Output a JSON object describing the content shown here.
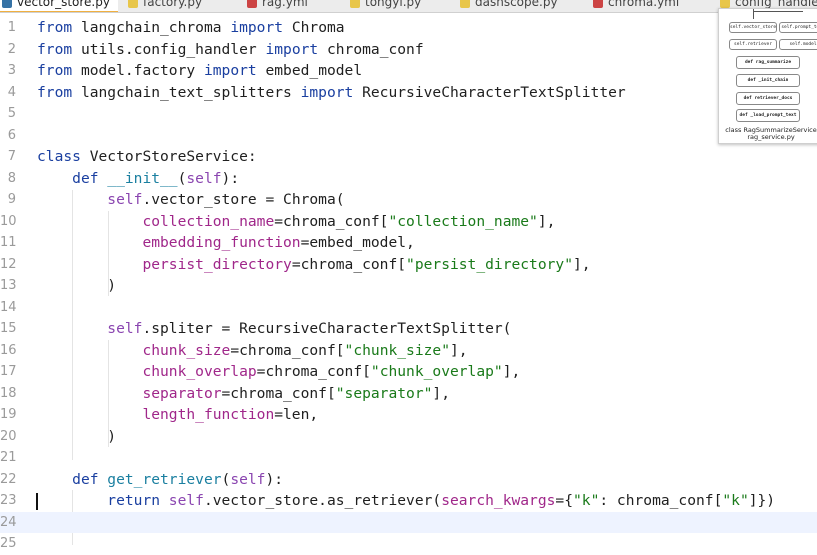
{
  "tabs": [
    {
      "label": "vector_store.py",
      "active": true,
      "icon": "python-file-icon",
      "color": "#3572A5"
    },
    {
      "label": "factory.py",
      "active": false,
      "icon": "python-file-icon",
      "color": "#e8c64a"
    },
    {
      "label": "rag.yml",
      "active": false,
      "icon": "yaml-file-icon",
      "color": "#cc4444"
    },
    {
      "label": "tongyi.py",
      "active": false,
      "icon": "python-file-icon",
      "color": "#e8c64a"
    },
    {
      "label": "dashscope.py",
      "active": false,
      "icon": "python-file-icon",
      "color": "#e8c64a"
    },
    {
      "label": "chroma.yml",
      "active": false,
      "icon": "yaml-file-icon",
      "color": "#cc4444"
    },
    {
      "label": "config_handler.py",
      "active": false,
      "icon": "python-file-icon",
      "color": "#e8c64a"
    }
  ],
  "editor": {
    "current_line": 24,
    "lines": [
      {
        "n": "1",
        "t": [
          [
            "kw",
            "from"
          ],
          [
            "",
            "langchain_chroma"
          ],
          [
            "kw",
            "import"
          ],
          [
            "",
            "Chroma"
          ]
        ]
      },
      {
        "n": "2",
        "t": [
          [
            "kw",
            "from"
          ],
          [
            "",
            "utils.config_handler"
          ],
          [
            "kw",
            "import"
          ],
          [
            "",
            "chroma_conf"
          ]
        ]
      },
      {
        "n": "3",
        "t": [
          [
            "kw",
            "from"
          ],
          [
            "",
            "model.factory"
          ],
          [
            "kw",
            "import"
          ],
          [
            "",
            "embed_model"
          ]
        ]
      },
      {
        "n": "4",
        "t": [
          [
            "kw",
            "from"
          ],
          [
            "",
            "langchain_text_splitters"
          ],
          [
            "kw",
            "import"
          ],
          [
            "",
            "RecursiveCharacterTextSplitter"
          ]
        ]
      },
      {
        "n": "5",
        "t": []
      },
      {
        "n": "6",
        "t": []
      },
      {
        "n": "7",
        "t": [
          [
            "kw",
            "class"
          ],
          [
            "",
            "VectorStoreService:"
          ]
        ]
      },
      {
        "n": "8",
        "t": [
          [
            "",
            "    "
          ],
          [
            "kw",
            "def"
          ],
          [
            "fn",
            "__init__"
          ],
          [
            "",
            "("
          ],
          [
            "sf",
            "self"
          ],
          [
            "",
            "):"
          ]
        ]
      },
      {
        "n": "9",
        "t": [
          [
            "",
            "        "
          ],
          [
            "sf",
            "self"
          ],
          [
            "",
            ".vector_store = Chroma("
          ]
        ]
      },
      {
        "n": "10",
        "t": [
          [
            "",
            "            "
          ],
          [
            "ar",
            "collection_name"
          ],
          [
            "",
            "=chroma_conf["
          ],
          [
            "st",
            "\"collection_name\""
          ],
          [
            "",
            "],"
          ]
        ]
      },
      {
        "n": "11",
        "t": [
          [
            "",
            "            "
          ],
          [
            "ar",
            "embedding_function"
          ],
          [
            "",
            "=embed_model,"
          ]
        ]
      },
      {
        "n": "12",
        "t": [
          [
            "",
            "            "
          ],
          [
            "ar",
            "persist_directory"
          ],
          [
            "",
            "=chroma_conf["
          ],
          [
            "st",
            "\"persist_directory\""
          ],
          [
            "",
            "],"
          ]
        ]
      },
      {
        "n": "13",
        "t": [
          [
            "",
            "        )"
          ]
        ]
      },
      {
        "n": "14",
        "t": []
      },
      {
        "n": "15",
        "t": [
          [
            "",
            "        "
          ],
          [
            "sf",
            "self"
          ],
          [
            "",
            ".spliter = RecursiveCharacterTextSplitter("
          ]
        ]
      },
      {
        "n": "16",
        "t": [
          [
            "",
            "            "
          ],
          [
            "ar",
            "chunk_size"
          ],
          [
            "",
            "=chroma_conf["
          ],
          [
            "st",
            "\"chunk_size\""
          ],
          [
            "",
            "],"
          ]
        ]
      },
      {
        "n": "17",
        "t": [
          [
            "",
            "            "
          ],
          [
            "ar",
            "chunk_overlap"
          ],
          [
            "",
            "=chroma_conf["
          ],
          [
            "st",
            "\"chunk_overlap\""
          ],
          [
            "",
            "],"
          ]
        ]
      },
      {
        "n": "18",
        "t": [
          [
            "",
            "            "
          ],
          [
            "ar",
            "separator"
          ],
          [
            "",
            "=chroma_conf["
          ],
          [
            "st",
            "\"separator\""
          ],
          [
            "",
            "],"
          ]
        ]
      },
      {
        "n": "19",
        "t": [
          [
            "",
            "            "
          ],
          [
            "ar",
            "length_function"
          ],
          [
            "",
            "=len,"
          ]
        ]
      },
      {
        "n": "20",
        "t": [
          [
            "",
            "        )"
          ]
        ]
      },
      {
        "n": "21",
        "t": []
      },
      {
        "n": "22",
        "t": [
          [
            "",
            "    "
          ],
          [
            "kw",
            "def"
          ],
          [
            "fn",
            "get_retriever"
          ],
          [
            "",
            "("
          ],
          [
            "sf",
            "self"
          ],
          [
            "",
            "):"
          ]
        ]
      },
      {
        "n": "23",
        "t": [
          [
            "",
            "        "
          ],
          [
            "kw",
            "return"
          ],
          [
            "sf",
            "self"
          ],
          [
            "",
            ".vector_store.as_retriever("
          ],
          [
            "ar",
            "search_kwargs"
          ],
          [
            "",
            "={"
          ],
          [
            "st",
            "\"k\""
          ],
          [
            "",
            ": chroma_conf["
          ],
          [
            "st",
            "\"k\""
          ],
          [
            "",
            "]})"
          ]
        ]
      },
      {
        "n": "24",
        "t": []
      },
      {
        "n": "25",
        "t": []
      }
    ]
  },
  "minimap": {
    "boxes": [
      {
        "label": "self.vector_store",
        "bold": false
      },
      {
        "label": "self.prompt_text",
        "bold": false
      },
      {
        "label": "self.retriever",
        "bold": false
      },
      {
        "label": "self.model",
        "bold": false
      },
      {
        "label": "def rag_summarize",
        "bold": true
      },
      {
        "label": "def _init_chain",
        "bold": true
      },
      {
        "label": "def retriever_docs",
        "bold": true
      },
      {
        "label": "def _load_prompt_text",
        "bold": true
      }
    ],
    "caption_1": "class RagSummarizeService",
    "caption_2": "rag_service.py"
  },
  "colors": {
    "keyword": "#1a3fa0",
    "self": "#8a45b0",
    "function": "#1a7fa0",
    "string": "#1a7a1a",
    "argument": "#a0278a"
  }
}
